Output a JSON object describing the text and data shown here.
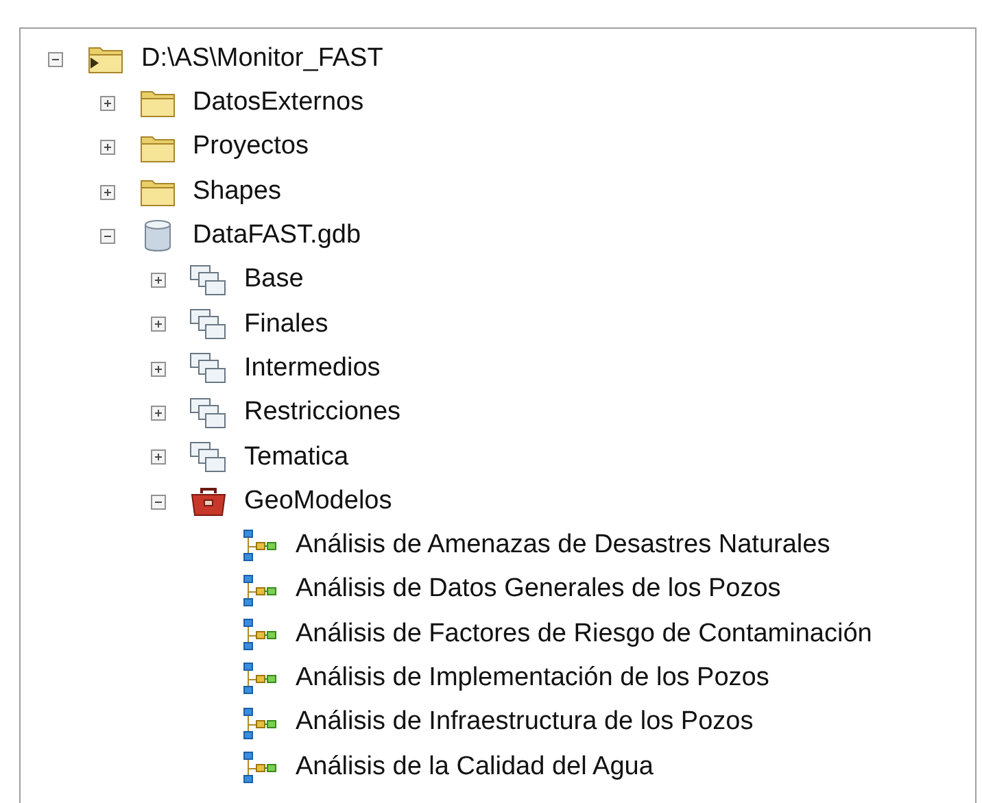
{
  "tree": [
    {
      "label": "D:\\AS\\Monitor_FAST",
      "kind": "folder-link",
      "expanded": true,
      "children": [
        {
          "label": "DatosExternos",
          "kind": "folder",
          "expanded": false
        },
        {
          "label": "Proyectos",
          "kind": "folder",
          "expanded": false
        },
        {
          "label": "Shapes",
          "kind": "folder",
          "expanded": false
        },
        {
          "label": "DataFAST.gdb",
          "kind": "geodatabase",
          "expanded": true,
          "children": [
            {
              "label": "Base",
              "kind": "dataset",
              "expanded": false
            },
            {
              "label": "Finales",
              "kind": "dataset",
              "expanded": false
            },
            {
              "label": "Intermedios",
              "kind": "dataset",
              "expanded": false
            },
            {
              "label": "Restricciones",
              "kind": "dataset",
              "expanded": false
            },
            {
              "label": "Tematica",
              "kind": "dataset",
              "expanded": false
            },
            {
              "label": "GeoModelos",
              "kind": "toolbox",
              "expanded": true,
              "children": [
                {
                  "label": "Análisis de Amenazas de Desastres Naturales",
                  "kind": "model"
                },
                {
                  "label": "Análisis de Datos Generales de los Pozos",
                  "kind": "model"
                },
                {
                  "label": "Análisis de Factores de Riesgo de Contaminación",
                  "kind": "model"
                },
                {
                  "label": "Análisis de Implementación de los Pozos",
                  "kind": "model"
                },
                {
                  "label": "Análisis de Infraestructura de los Pozos",
                  "kind": "model"
                },
                {
                  "label": "Análisis de la Calidad del Agua",
                  "kind": "model"
                }
              ]
            }
          ]
        }
      ]
    }
  ]
}
